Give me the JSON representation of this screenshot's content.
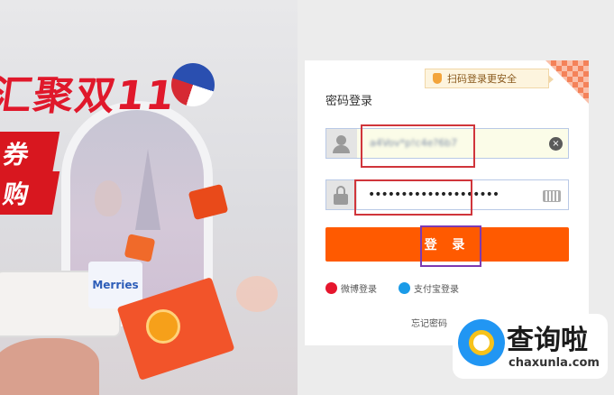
{
  "banner": {
    "title": "汇聚双11",
    "ribbon1": "券",
    "ribbon2": "购",
    "product_label": "Merries"
  },
  "login": {
    "scan_tip": "扫码登录更安全",
    "title": "密码登录",
    "username_value": "a4Vov*p!c4e?6b7",
    "password_value": "••••••••••••••••••••",
    "clear_icon": "×",
    "login_button": "登 录",
    "weibo_label": "微博登录",
    "alipay_label": "支付宝登录",
    "forgot_label": "忘记密码"
  },
  "watermark": {
    "title": "查询啦",
    "url": "chaxunla.com"
  },
  "colors": {
    "accent": "#ff5a00",
    "highlight_red": "#d0353b",
    "highlight_purple": "#7c3ab2",
    "tip_bg": "#fdf4de"
  }
}
